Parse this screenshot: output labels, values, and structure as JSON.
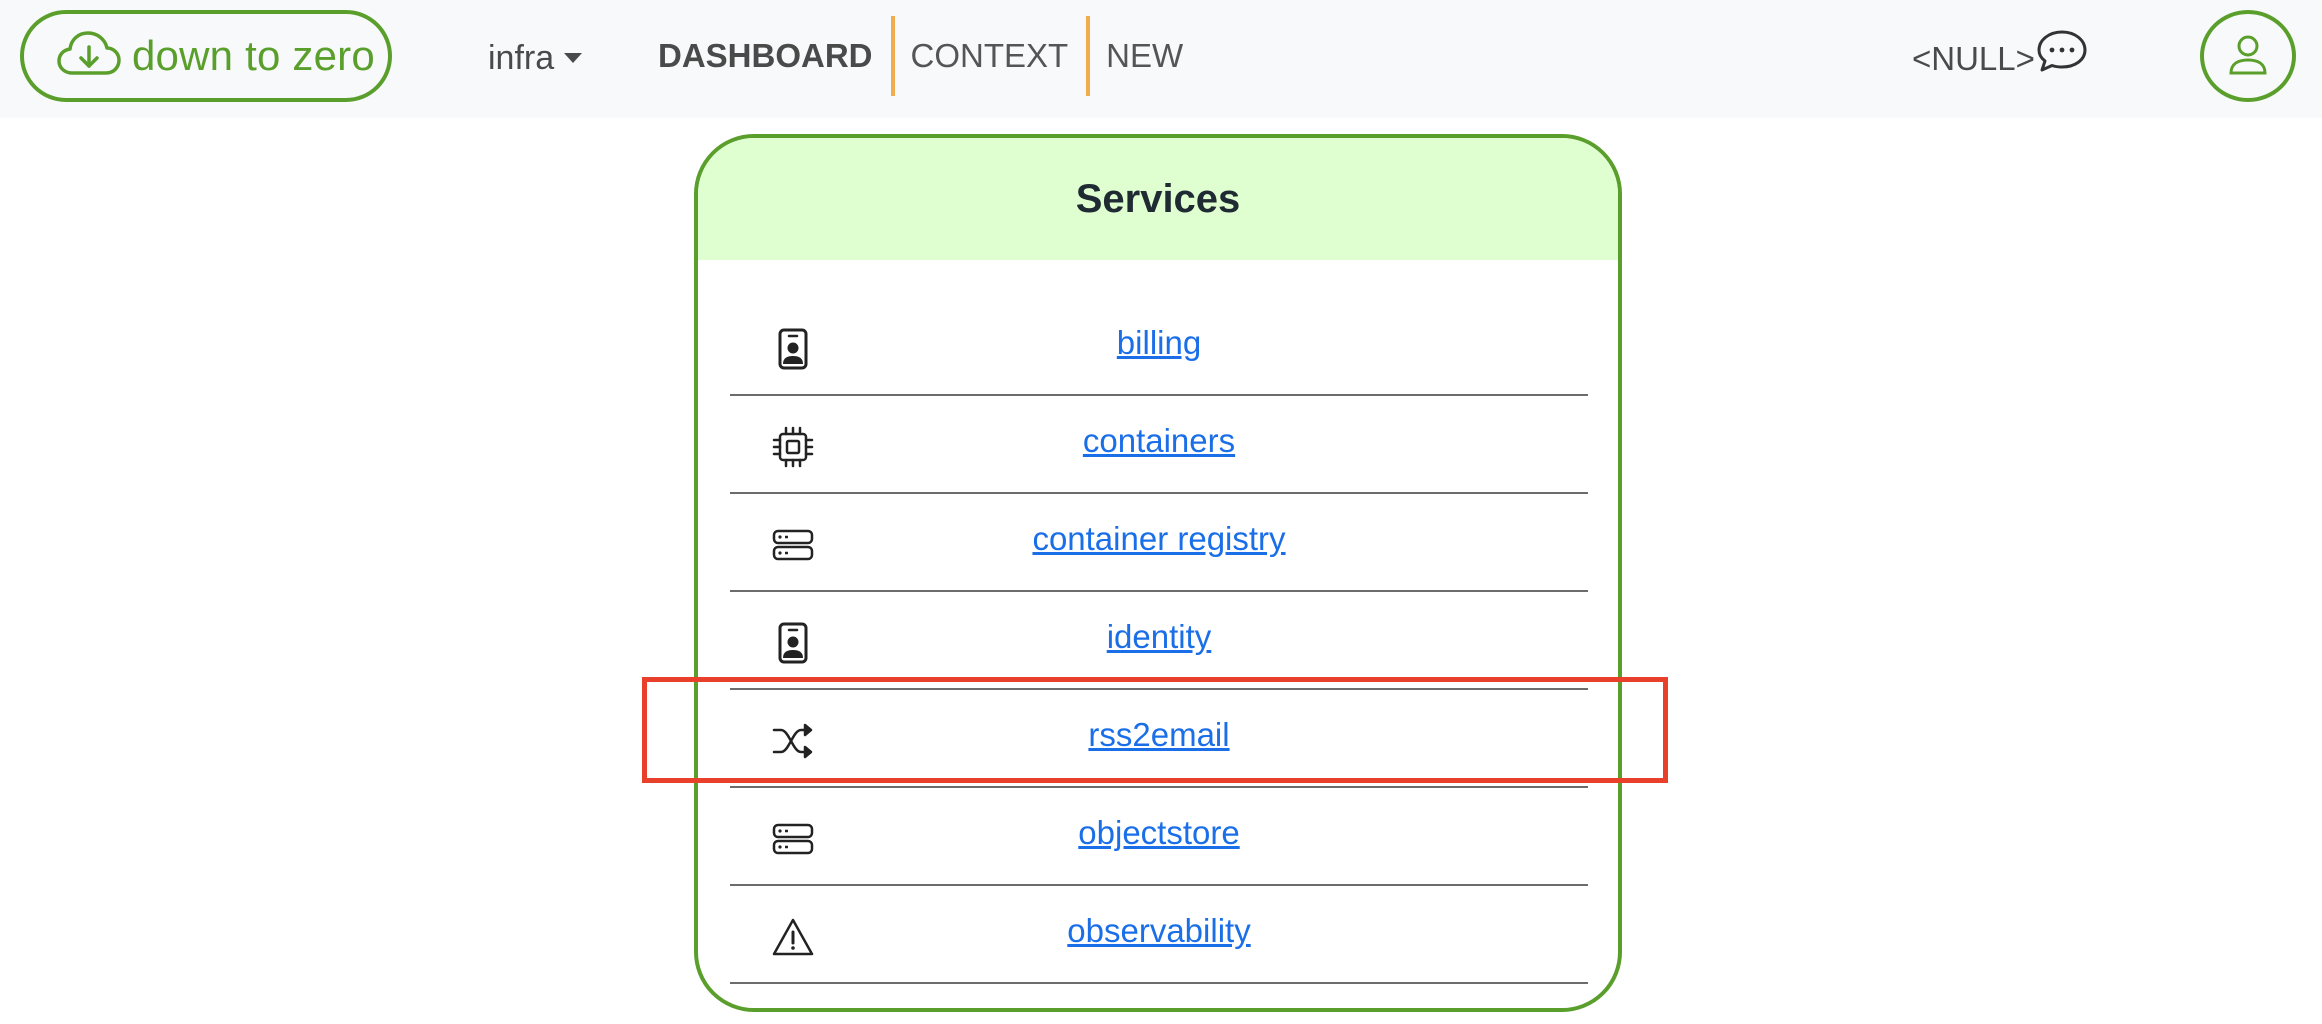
{
  "brand": {
    "label": "down to zero",
    "icon": "cloud-download-icon",
    "color": "#5a9f2c"
  },
  "nav": {
    "dropdown_label": "infra",
    "links": [
      "DASHBOARD",
      "CONTEXT",
      "NEW"
    ],
    "separator_color": "#f0ad4e"
  },
  "header_right": {
    "null_label": "<NULL>",
    "chat_icon": "chat-dots-icon",
    "user_icon": "person-icon"
  },
  "services": {
    "title": "Services",
    "header_bg": "#dfffd0",
    "link_color": "#1a6fe8",
    "items": [
      {
        "label": "billing",
        "icon": "person-badge-icon"
      },
      {
        "label": "containers",
        "icon": "cpu-icon"
      },
      {
        "label": "container registry",
        "icon": "server-icon"
      },
      {
        "label": "identity",
        "icon": "person-badge-icon"
      },
      {
        "label": "rss2email",
        "icon": "shuffle-icon"
      },
      {
        "label": "objectstore",
        "icon": "server-icon"
      },
      {
        "label": "observability",
        "icon": "warning-triangle-icon"
      }
    ]
  },
  "annotation": {
    "highlighted_item": "rss2email",
    "color": "#e8402a"
  }
}
